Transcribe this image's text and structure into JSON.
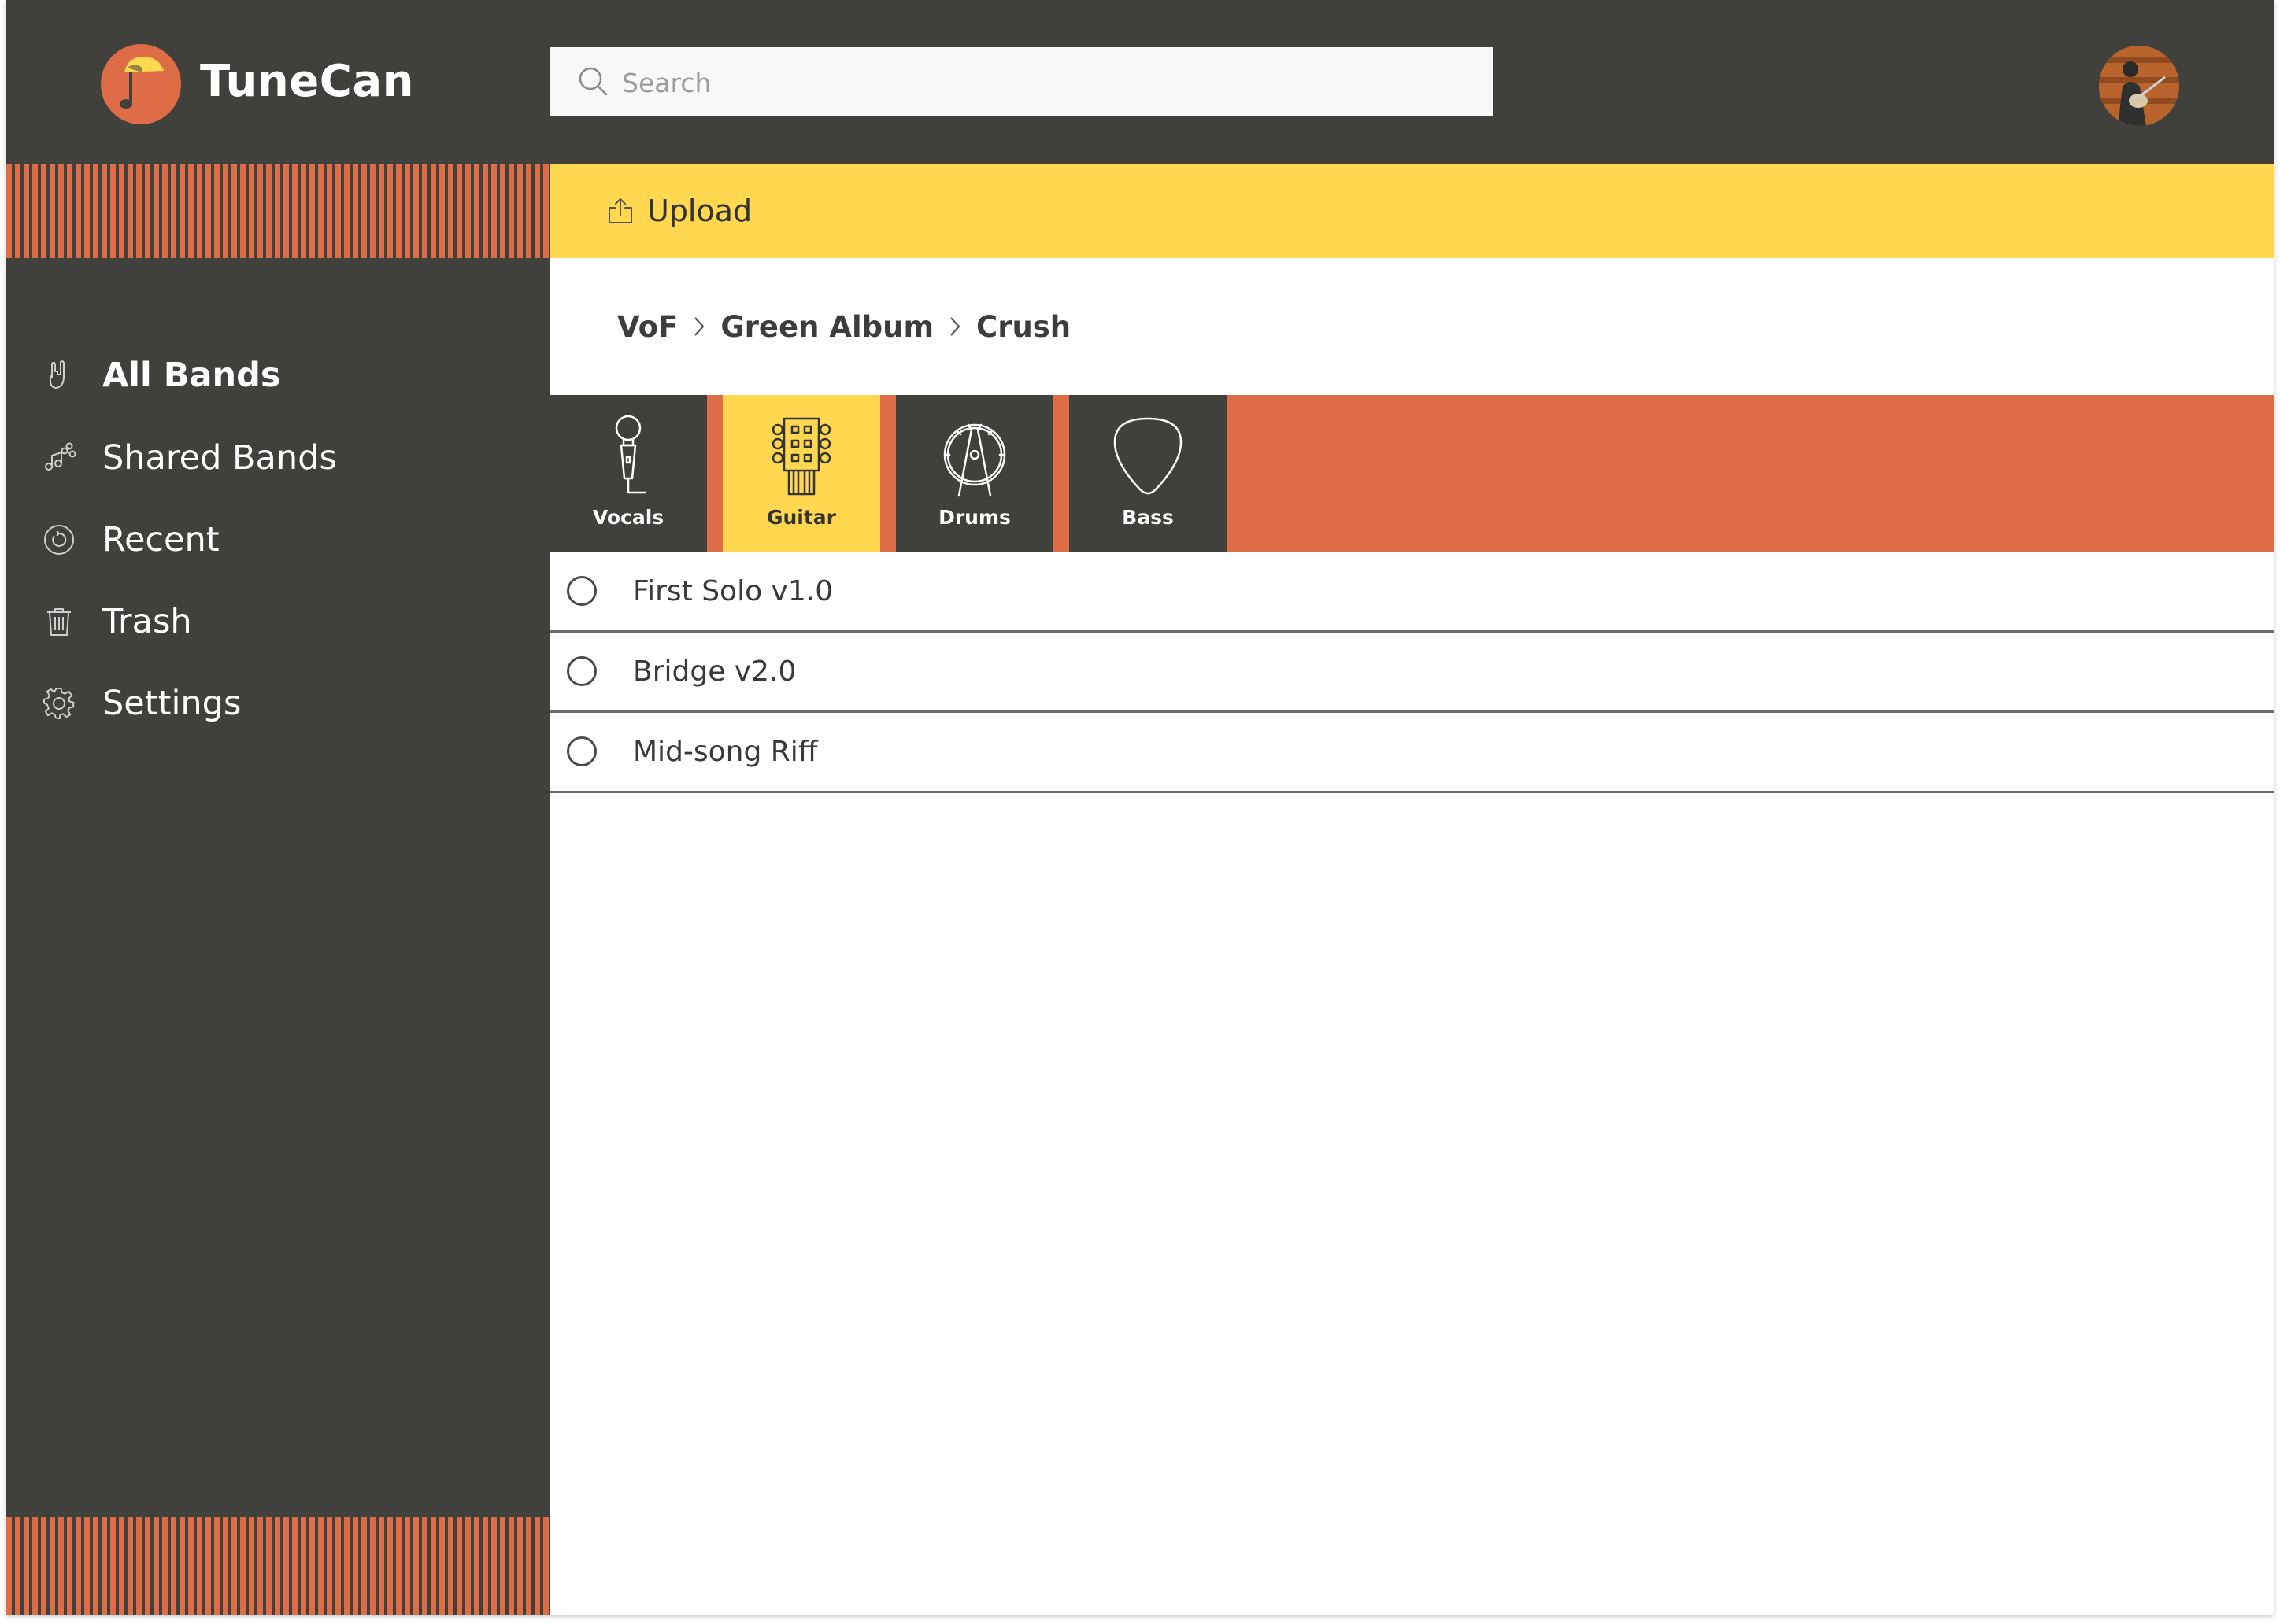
{
  "app": {
    "title": "TuneCan"
  },
  "search": {
    "placeholder": "Search",
    "value": ""
  },
  "toolbar": {
    "upload_label": "Upload"
  },
  "sidebar": {
    "items": [
      {
        "label": "All Bands",
        "icon": "rock-hand-icon",
        "active": true
      },
      {
        "label": "Shared Bands",
        "icon": "shared-music-icon",
        "active": false
      },
      {
        "label": "Recent",
        "icon": "recent-clock-icon",
        "active": false
      },
      {
        "label": "Trash",
        "icon": "trash-icon",
        "active": false
      },
      {
        "label": "Settings",
        "icon": "gear-icon",
        "active": false
      }
    ]
  },
  "breadcrumb": {
    "items": [
      "VoF",
      "Green Album",
      "Crush"
    ]
  },
  "tabs": [
    {
      "label": "Vocals",
      "icon": "microphone-icon",
      "active": false
    },
    {
      "label": "Guitar",
      "icon": "guitar-headstock-icon",
      "active": true
    },
    {
      "label": "Drums",
      "icon": "drum-icon",
      "active": false
    },
    {
      "label": "Bass",
      "icon": "guitar-pick-icon",
      "active": false
    }
  ],
  "tracks": [
    {
      "name": "First Solo v1.0",
      "selected": false
    },
    {
      "name": "Bridge v2.0",
      "selected": false
    },
    {
      "name": "Mid-song Riff",
      "selected": false
    }
  ],
  "colors": {
    "dark": "#40403c",
    "accent_orange": "#de6c47",
    "accent_yellow": "#ffd84f",
    "text_dark": "#3d3d3d",
    "search_bg": "#f7f8f7"
  }
}
